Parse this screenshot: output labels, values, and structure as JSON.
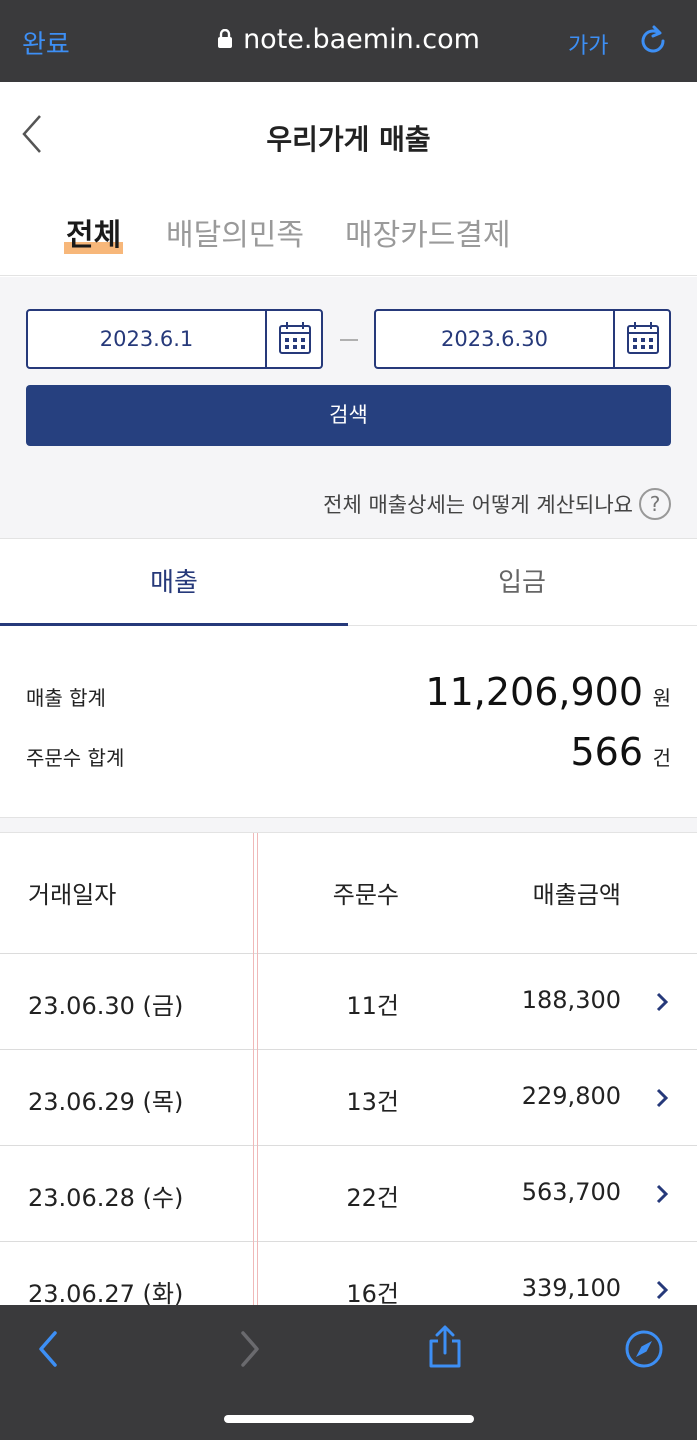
{
  "browser": {
    "done_label": "완료",
    "url": "note.baemin.com",
    "font_size_label": "가가",
    "accent_color": "#3d8ff5"
  },
  "header": {
    "title": "우리가게 매출"
  },
  "category_tabs": [
    {
      "label": "전체",
      "active": true
    },
    {
      "label": "배달의민족",
      "active": false
    },
    {
      "label": "매장카드결제",
      "active": false
    }
  ],
  "filter": {
    "start_date": "2023.6.1",
    "end_date": "2023.6.30",
    "search_label": "검색",
    "help_text": "전체 매출상세는 어떻게 계산되나요",
    "help_icon_label": "?",
    "brand_color": "#26397a"
  },
  "summary_tabs": [
    {
      "label": "매출",
      "active": true
    },
    {
      "label": "입금",
      "active": false
    }
  ],
  "totals": {
    "sales_label": "매출 합계",
    "sales_value": "11,206,900",
    "sales_unit": "원",
    "orders_label": "주문수 합계",
    "orders_value": "566",
    "orders_unit": "건"
  },
  "table": {
    "headers": [
      "거래일자",
      "주문수",
      "매출금액"
    ],
    "rows": [
      {
        "date": "23.06.30 (금)",
        "orders": "11건",
        "amount": "188,300"
      },
      {
        "date": "23.06.29 (목)",
        "orders": "13건",
        "amount": "229,800"
      },
      {
        "date": "23.06.28 (수)",
        "orders": "22건",
        "amount": "563,700"
      },
      {
        "date": "23.06.27 (화)",
        "orders": "16건",
        "amount": "339,100"
      }
    ]
  },
  "bottom_bar": {
    "icons": [
      "back-icon",
      "forward-icon",
      "share-icon",
      "compass-icon"
    ]
  }
}
